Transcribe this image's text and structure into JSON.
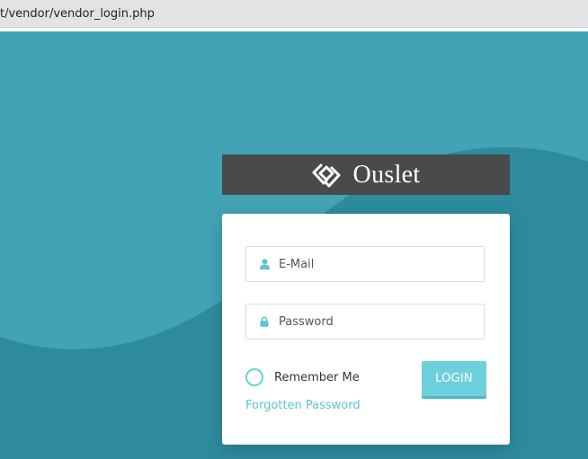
{
  "browser": {
    "url": "t/vendor/vendor_login.php"
  },
  "brand": {
    "name": "Ouslet",
    "logo_icon": "diamond-logo-icon"
  },
  "form": {
    "email_placeholder": "E-Mail",
    "email_icon": "user-icon",
    "password_placeholder": "Password",
    "password_icon": "lock-icon",
    "remember_label": "Remember Me",
    "remember_checked": false,
    "login_label": "LOGIN",
    "forgot_label": "Forgotten Password"
  },
  "colors": {
    "background": "#42a3b6",
    "wave": "#2e8b9e",
    "brand_bar": "#4a4a4a",
    "accent": "#6dd0dd",
    "link": "#5bc4d2"
  }
}
